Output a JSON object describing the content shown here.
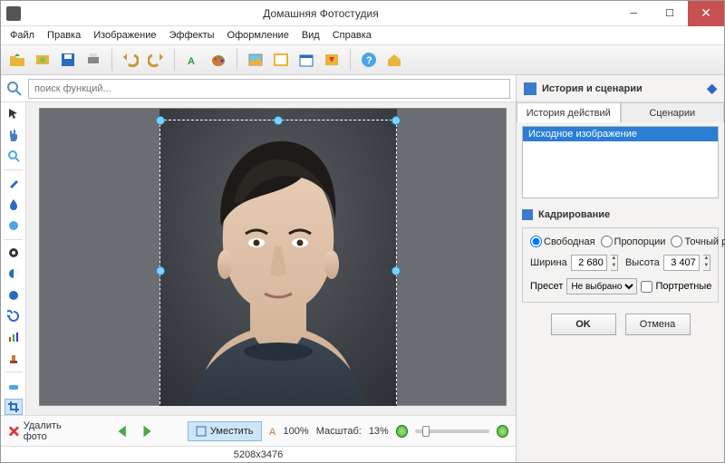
{
  "window": {
    "title": "Домашняя Фотостудия"
  },
  "menu": {
    "items": [
      "Файл",
      "Правка",
      "Изображение",
      "Эффекты",
      "Оформление",
      "Вид",
      "Справка"
    ]
  },
  "search": {
    "placeholder": "поиск функций..."
  },
  "right": {
    "heading": "История и сценарии",
    "tabs": [
      "История действий",
      "Сценарии"
    ],
    "history_item": "Исходное изображение",
    "crop_heading": "Кадрирование",
    "radios": [
      "Свободная",
      "Пропорции",
      "Точный размер"
    ],
    "width_label": "Ширина",
    "width_value": "2 680",
    "height_label": "Высота",
    "height_value": "3 407",
    "preset_label": "Пресет",
    "preset_value": "Не выбрано",
    "portrait_label": "Портретные",
    "ok": "OK",
    "cancel": "Отмена"
  },
  "bottom": {
    "delete": "Удалить фото",
    "fit": "Уместить",
    "zoom100": "100%",
    "scale_label": "Масштаб:",
    "scale_value": "13%"
  },
  "status": {
    "dims": "5208x3476"
  }
}
